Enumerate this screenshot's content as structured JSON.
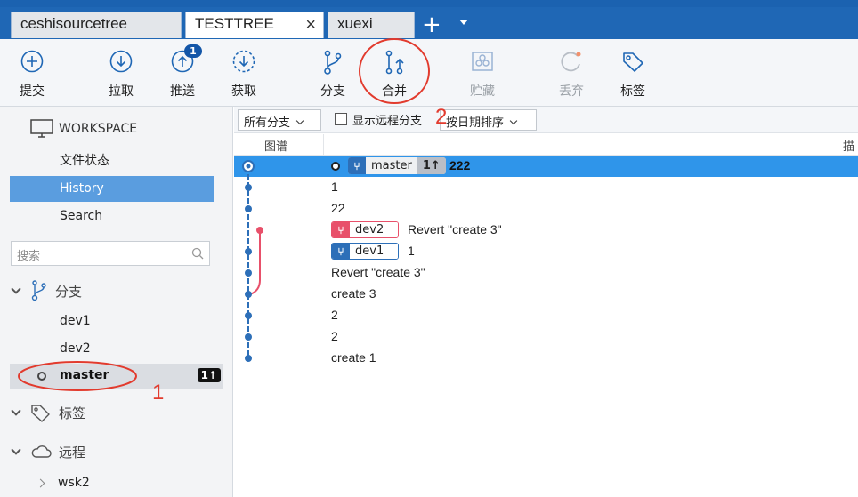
{
  "tabs": [
    {
      "label": "ceshisourcetree",
      "active": false
    },
    {
      "label": "TESTTREE",
      "active": true,
      "close": "×"
    },
    {
      "label": "xuexi",
      "active": false
    }
  ],
  "tab_add": "+",
  "toolbar": {
    "commit": "提交",
    "pull": "拉取",
    "push": "推送",
    "push_badge": "1",
    "fetch": "获取",
    "branch": "分支",
    "merge": "合并",
    "stash": "贮藏",
    "discard": "丢弃",
    "tag": "标签"
  },
  "sidebar": {
    "workspace": "WORKSPACE",
    "items": [
      {
        "label": "文件状态",
        "selected": false
      },
      {
        "label": "History",
        "selected": true
      },
      {
        "label": "Search",
        "selected": false
      }
    ],
    "search_placeholder": "搜索",
    "branches_header": "分支",
    "branches": [
      "dev1",
      "dev2"
    ],
    "current_branch": "master",
    "current_sync": "1↑",
    "tags_header": "标签",
    "remotes_header": "远程",
    "remotes": [
      "wsk2"
    ]
  },
  "filter": {
    "branches": "所有分支",
    "show_remote": "显示远程分支",
    "sort": "按日期排序"
  },
  "columns": {
    "graph": "图谱",
    "description": "描"
  },
  "commits": [
    {
      "message": "222",
      "tags": [
        {
          "name": "master",
          "kind": "local-current"
        },
        {
          "name": "1↑",
          "kind": "sync"
        }
      ],
      "selected": true
    },
    {
      "message": "1",
      "tags": []
    },
    {
      "message": "22",
      "tags": []
    },
    {
      "message": "Revert \"create 3\"",
      "tags": [
        {
          "name": "dev2",
          "kind": "local-red"
        }
      ]
    },
    {
      "message": "1",
      "tags": [
        {
          "name": "dev1",
          "kind": "local-blue"
        }
      ]
    },
    {
      "message": "Revert \"create 3\"",
      "tags": []
    },
    {
      "message": "create 3",
      "tags": []
    },
    {
      "message": "2",
      "tags": []
    },
    {
      "message": "2",
      "tags": []
    },
    {
      "message": "create 1",
      "tags": []
    }
  ],
  "annotations": {
    "one": "1",
    "two": "2"
  },
  "colors": {
    "accent": "#1f67b5",
    "selection": "#2f95ea",
    "graph_blue": "#2d6fb8",
    "graph_red": "#e8506a",
    "annotation": "#e23b2e"
  }
}
